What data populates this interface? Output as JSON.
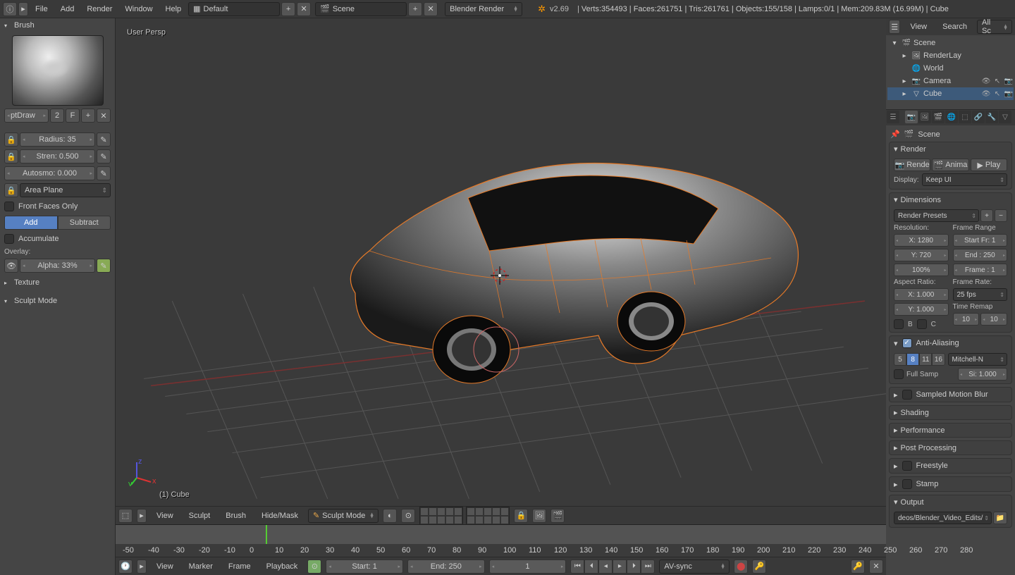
{
  "topbar": {
    "menus": [
      "File",
      "Add",
      "Render",
      "Window",
      "Help"
    ],
    "layout": "Default",
    "scene": "Scene",
    "engine": "Blender Render",
    "version": "v2.69",
    "stats": "Verts:354493 | Faces:261751 | Tris:261761 | Objects:155/158 | Lamps:0/1 | Mem:209.83M (16.99M) | Cube"
  },
  "left": {
    "brush_header": "Brush",
    "brush_name": "ptDraw",
    "brush_users": "2",
    "fake": "F",
    "radius_label": "Radius: 35",
    "strength_label": "Stren: 0.500",
    "autosmooth_label": "Autosmo: 0.000",
    "plane": "Area Plane",
    "front_faces": "Front Faces Only",
    "add": "Add",
    "subtract": "Subtract",
    "accumulate": "Accumulate",
    "overlay": "Overlay:",
    "alpha": "Alpha: 33%",
    "texture_header": "Texture",
    "sculpt_header": "Sculpt Mode"
  },
  "viewport": {
    "persp": "User Persp",
    "object_label": "(1) Cube",
    "menus": [
      "View",
      "Sculpt",
      "Brush",
      "Hide/Mask"
    ],
    "mode": "Sculpt Mode"
  },
  "timeline": {
    "menus": [
      "View",
      "Marker",
      "Frame",
      "Playback"
    ],
    "start_label": "Start: 1",
    "end_label": "End: 250",
    "current": "1",
    "sync": "AV-sync",
    "ticks": [
      "-50",
      "-40",
      "-30",
      "-20",
      "-10",
      "0",
      "10",
      "20",
      "30",
      "40",
      "50",
      "60",
      "70",
      "80",
      "90",
      "100",
      "110",
      "120",
      "130",
      "140",
      "150",
      "160",
      "170",
      "180",
      "190",
      "200",
      "210",
      "220",
      "230",
      "240",
      "250",
      "260",
      "270",
      "280"
    ]
  },
  "outliner": {
    "menus": [
      "View",
      "Search"
    ],
    "filter": "All Sc",
    "tree": [
      {
        "indent": 0,
        "icon": "🎬",
        "label": "Scene",
        "expand": "▾"
      },
      {
        "indent": 1,
        "icon": "🖼",
        "label": "RenderLay",
        "expand": "▸"
      },
      {
        "indent": 1,
        "icon": "🌐",
        "label": "World",
        "expand": ""
      },
      {
        "indent": 1,
        "icon": "📷",
        "label": "Camera",
        "expand": "▸",
        "icons": true
      },
      {
        "indent": 1,
        "icon": "▽",
        "label": "Cube",
        "expand": "▸",
        "icons": true,
        "active": true
      }
    ]
  },
  "props": {
    "breadcrumb": "Scene",
    "render_header": "Render",
    "render_btn": "Rende",
    "anim_btn": "Anima",
    "play_btn": "Play",
    "display_label": "Display:",
    "display_value": "Keep UI",
    "dimensions_header": "Dimensions",
    "presets": "Render Presets",
    "resolution_label": "Resolution:",
    "res_x": "X: 1280",
    "res_y": "Y: 720",
    "res_pct": "100%",
    "frame_range_label": "Frame Range",
    "start_fr": "Start Fr: 1",
    "end_fr": "End : 250",
    "frame_step": "Frame : 1",
    "aspect_label": "Aspect Ratio:",
    "asp_x": "X: 1.000",
    "asp_y": "Y: 1.000",
    "framerate_label": "Frame Rate:",
    "fps": "25 fps",
    "time_remap": "Time Remap",
    "old": "10",
    "new": "10",
    "border_b": "B",
    "border_c": "C",
    "aa_header": "Anti-Aliasing",
    "aa_samples": [
      "5",
      "8",
      "11",
      "16"
    ],
    "aa_filter": "Mitchell-N",
    "full_sample": "Full Samp",
    "aa_size": "Si: 1.000",
    "collapsed": [
      "Sampled Motion Blur",
      "Shading",
      "Performance",
      "Post Processing",
      "Freestyle",
      "Stamp"
    ],
    "output_header": "Output",
    "output_path": "deos/Blender_Video_Edits/"
  }
}
